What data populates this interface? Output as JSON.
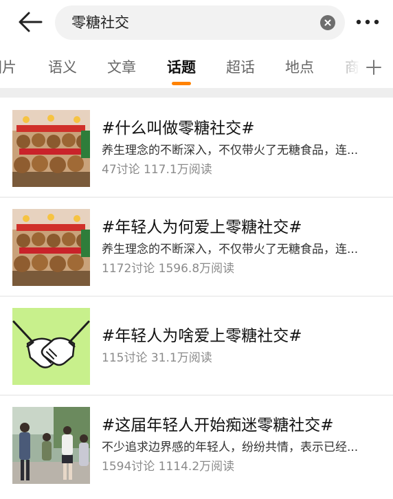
{
  "header": {
    "search_query": "零糖社交"
  },
  "tabs": [
    {
      "label": "图片"
    },
    {
      "label": "语义"
    },
    {
      "label": "文章"
    },
    {
      "label": "话题"
    },
    {
      "label": "超话"
    },
    {
      "label": "地点"
    },
    {
      "label": "商"
    }
  ],
  "active_tab": "话题",
  "accent_color": "#ff8200",
  "topics": [
    {
      "title": "#什么叫做零糖社交#",
      "description": "养生理念的不断深入，不仅带火了无糖食品，连...",
      "stats": "47讨论 117.1万阅读",
      "thumbnail": "capybara-plush-display-image"
    },
    {
      "title": "#年轻人为何爱上零糖社交#",
      "description": "养生理念的不断深入，不仅带火了无糖食品，连...",
      "stats": "1172讨论 1596.8万阅读",
      "thumbnail": "capybara-plush-display-image"
    },
    {
      "title": "#年轻人为啥爱上零糖社交#",
      "description": "",
      "stats": "115讨论 31.1万阅读",
      "thumbnail": "handshake-illustration"
    },
    {
      "title": "#这届年轻人开始痴迷零糖社交#",
      "description": "不少追求边界感的年轻人，纷纷共情，表示已经...",
      "stats": "1594讨论 1114.2万阅读",
      "thumbnail": "people-street-photo"
    }
  ]
}
